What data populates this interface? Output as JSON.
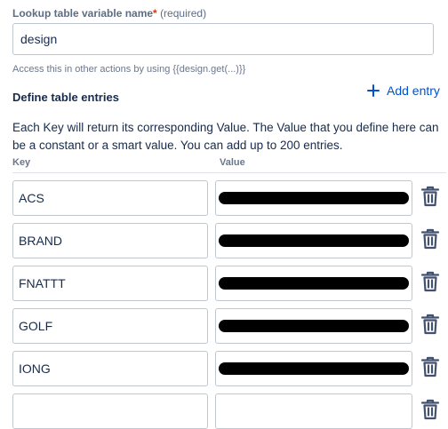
{
  "lookup_field": {
    "label": "Lookup table variable name",
    "required_star": "*",
    "required_text": "(required)",
    "value": "design",
    "helper": "Access this in other actions by using {{design.get(...)}}"
  },
  "section": {
    "title": "Define table entries",
    "add_entry_label": "Add entry",
    "description": "Each Key will return its corresponding Value. The Value that you define here can be a constant or a smart value. You can add up to 200 entries."
  },
  "columns": {
    "key": "Key",
    "value": "Value"
  },
  "entries": [
    {
      "key": "ACS",
      "value_redacted": true
    },
    {
      "key": "BRAND",
      "value_redacted": true
    },
    {
      "key": "FNATTT",
      "value_redacted": true
    },
    {
      "key": "GOLF",
      "value_redacted": true
    },
    {
      "key": "IONG",
      "value_redacted": true
    },
    {
      "key": "",
      "value_redacted": false
    }
  ],
  "icons": {
    "add": "plus-icon",
    "delete": "trash-icon"
  },
  "colors": {
    "link": "#0052cc",
    "required": "#de350b",
    "icon": "#42526e",
    "border": "#c1c7d0",
    "redaction": "#000000"
  }
}
